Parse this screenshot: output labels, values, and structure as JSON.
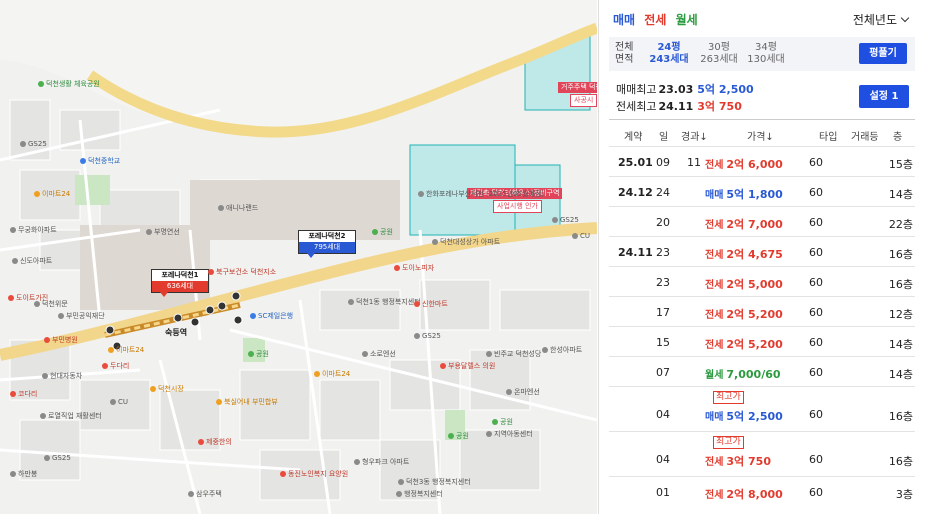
{
  "map": {
    "markers": [
      {
        "title": "포레나덕천1",
        "count": "636세대",
        "color": "red"
      },
      {
        "title": "포레나덕천2",
        "count": "795세대",
        "color": "blue"
      }
    ],
    "zones": {
      "a_name": "재건축 덕천3(하우스)정비구역",
      "a_status": "사업시행 인가",
      "b_name": "거주주택 덕천",
      "b_status": "사공시"
    },
    "station": "숙등역",
    "pois": {
      "p01": "덕천생활 체육공원",
      "p02": "GS25",
      "p03": "덕천중학교",
      "p04": "이마트24",
      "p05": "무궁화아파트",
      "p06": "신도아파트",
      "p07": "도이트가진",
      "p08": "부민공익재단",
      "p09": "부민병원",
      "p10": "덕천위문",
      "p11": "애니나랜드",
      "p12": "부명연선",
      "p13": "북구보건소 덕천지소",
      "p14": "SC제일은행",
      "p15": "공원",
      "p16": "이마트24",
      "p17": "두다리",
      "p18": "현대자동차",
      "p19": "코다리",
      "p20": "로열직업 재활센터",
      "p21": "GS25",
      "p22": "하만봉",
      "p23": "덕천시장",
      "p24": "CU",
      "p25": "북실어내 부민합뷰",
      "p26": "제중한의",
      "p27": "삼우주택",
      "p28": "동진노인복지 요양원",
      "p29": "형우파크 아파트",
      "p30": "행정복지센터",
      "p31": "이마트24",
      "p32": "소로엔선",
      "p33": "덕천1동 행정복지센터",
      "p34": "도이노피자",
      "p35": "신한마트",
      "p36": "GS25",
      "p37": "부용달렐스 의원",
      "p38": "빈주교 덕천성당",
      "p39": "한성아파트",
      "p40": "온마엔선",
      "p41": "공원",
      "p42": "공원",
      "p43": "지역아동센터",
      "p44": "한화포레나부산덕천 (2025년05월예정)",
      "p45": "덕천대성상가 아파트",
      "p46": "공원",
      "p47": "CU",
      "p48": "GS25",
      "p49": "덕천3동 행정복지센터"
    }
  },
  "panel": {
    "tabs": [
      "매매",
      "전세",
      "월세"
    ],
    "year_filter": "전체년도",
    "size": {
      "label_top": "전체",
      "label_bottom": "면적",
      "cols": [
        {
          "py": "24평",
          "units": "243세대",
          "active": true
        },
        {
          "py": "30평",
          "units": "263세대",
          "active": false
        },
        {
          "py": "34평",
          "units": "130세대",
          "active": false
        }
      ],
      "button": "평풀기"
    },
    "max_sale": {
      "label": "매매최고",
      "date": "23.03",
      "price": "5억 2,500"
    },
    "max_jeonse": {
      "label": "전세최고",
      "date": "24.11",
      "price": "3억 750"
    },
    "settings_button": "설정 1",
    "headers": {
      "contract": "계약",
      "day": "일",
      "elapsed": "경과↓",
      "price": "가격↓",
      "type": "타입",
      "count": "거래등",
      "floor": "층"
    },
    "rows": [
      {
        "ym": "25.01",
        "day": "09",
        "elapsed": "11",
        "kind": "전세",
        "kind_class": "k-jeon",
        "price": "2억 6,000",
        "type": "60",
        "floor": "15층",
        "tag": ""
      },
      {
        "ym": "24.12",
        "day": "24",
        "elapsed": "",
        "kind": "매매",
        "kind_class": "k-sale",
        "price": "5억 1,800",
        "type": "60",
        "floor": "14층",
        "tag": ""
      },
      {
        "ym": "",
        "day": "20",
        "elapsed": "",
        "kind": "전세",
        "kind_class": "k-jeon",
        "price": "2억 7,000",
        "type": "60",
        "floor": "22층",
        "tag": ""
      },
      {
        "ym": "24.11",
        "day": "23",
        "elapsed": "",
        "kind": "전세",
        "kind_class": "k-jeon",
        "price": "2억 4,675",
        "type": "60",
        "floor": "16층",
        "tag": ""
      },
      {
        "ym": "",
        "day": "23",
        "elapsed": "",
        "kind": "전세",
        "kind_class": "k-jeon",
        "price": "2억 5,000",
        "type": "60",
        "floor": "16층",
        "tag": ""
      },
      {
        "ym": "",
        "day": "17",
        "elapsed": "",
        "kind": "전세",
        "kind_class": "k-jeon",
        "price": "2억 5,200",
        "type": "60",
        "floor": "12층",
        "tag": ""
      },
      {
        "ym": "",
        "day": "15",
        "elapsed": "",
        "kind": "전세",
        "kind_class": "k-jeon",
        "price": "2억 5,200",
        "type": "60",
        "floor": "14층",
        "tag": ""
      },
      {
        "ym": "",
        "day": "07",
        "elapsed": "",
        "kind": "월세",
        "kind_class": "k-wol",
        "price": "7,000/60",
        "type": "60",
        "floor": "14층",
        "tag": ""
      },
      {
        "ym": "",
        "day": "04",
        "elapsed": "",
        "kind": "매매",
        "kind_class": "k-sale",
        "price": "5억 2,500",
        "type": "60",
        "floor": "16층",
        "tag": "최고가"
      },
      {
        "ym": "",
        "day": "04",
        "elapsed": "",
        "kind": "전세",
        "kind_class": "k-jeon",
        "price": "3억 750",
        "type": "60",
        "floor": "16층",
        "tag": "최고가"
      },
      {
        "ym": "",
        "day": "01",
        "elapsed": "",
        "kind": "전세",
        "kind_class": "k-jeon",
        "price": "2억 8,000",
        "type": "60",
        "floor": "3층",
        "tag": ""
      }
    ]
  },
  "colors": {
    "sale": "#2a59d4",
    "jeonse": "#e23b2e",
    "wolse": "#2b9a3e",
    "button": "#1f4fe0"
  }
}
